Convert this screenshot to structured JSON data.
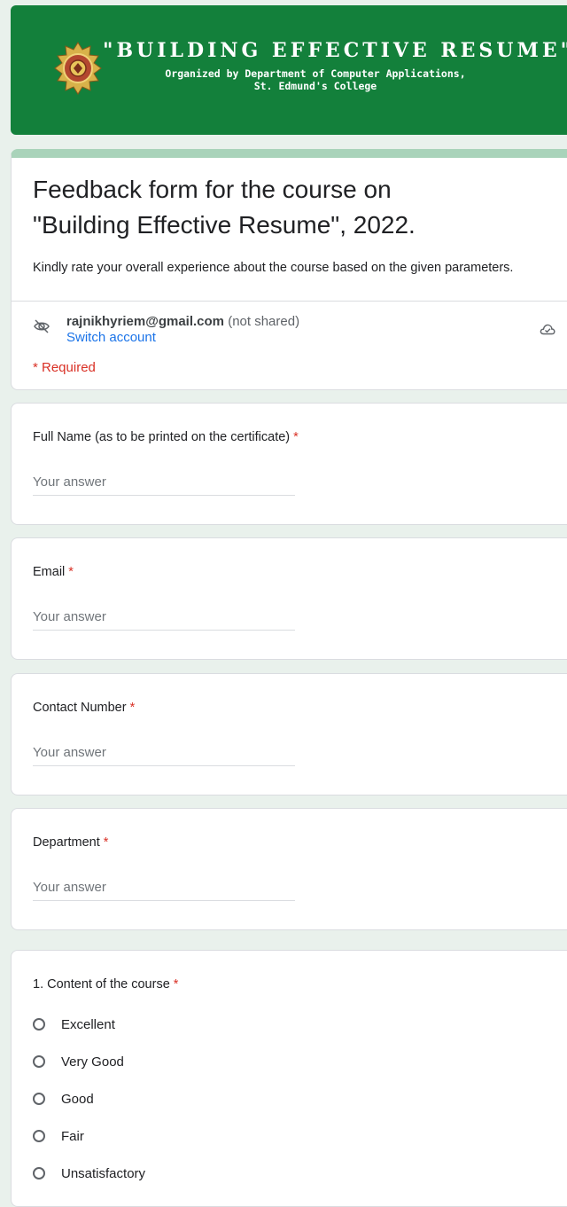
{
  "banner": {
    "title": "\"BUILDING EFFECTIVE RESUME\"",
    "subtitle_line1": "Organized by Department of Computer Applications,",
    "subtitle_line2": "St. Edmund's College"
  },
  "header": {
    "title": "Feedback form for the course on \"Building Effective Resume\", 2022.",
    "description": "Kindly rate your overall experience about the course based on the given parameters.",
    "account_email": "rajnikhyriem@gmail.com",
    "account_note": "(not shared)",
    "switch_account": "Switch account",
    "required_note": "* Required"
  },
  "questions": [
    {
      "label": "Full Name (as to be printed on the certificate)",
      "required_mark": "*",
      "placeholder": "Your answer"
    },
    {
      "label": "Email",
      "required_mark": "*",
      "placeholder": "Your answer"
    },
    {
      "label": "Contact Number",
      "required_mark": "*",
      "placeholder": "Your answer"
    },
    {
      "label": "Department",
      "required_mark": "*",
      "placeholder": "Your answer"
    }
  ],
  "rating_question": {
    "label": "1. Content of the course",
    "required_mark": "*",
    "options": [
      "Excellent",
      "Very Good",
      "Good",
      "Fair",
      "Unsatisfactory"
    ]
  },
  "colors": {
    "banner": "#13803b",
    "accent_stripe": "#a9d3ba",
    "background": "#e9f1ec",
    "required": "#d93025",
    "link": "#1a73e8"
  },
  "icons": {
    "visibility": "eye-off-icon",
    "cloud": "cloud-done-icon",
    "seal": "college-seal-icon"
  }
}
